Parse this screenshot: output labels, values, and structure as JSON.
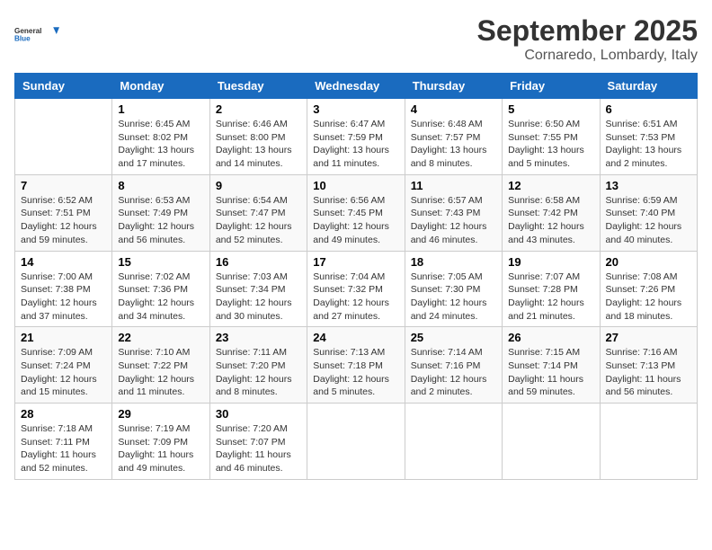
{
  "header": {
    "logo_line1": "General",
    "logo_line2": "Blue",
    "month_title": "September 2025",
    "location": "Cornaredo, Lombardy, Italy"
  },
  "days_of_week": [
    "Sunday",
    "Monday",
    "Tuesday",
    "Wednesday",
    "Thursday",
    "Friday",
    "Saturday"
  ],
  "weeks": [
    [
      {
        "day": "",
        "info": ""
      },
      {
        "day": "1",
        "info": "Sunrise: 6:45 AM\nSunset: 8:02 PM\nDaylight: 13 hours\nand 17 minutes."
      },
      {
        "day": "2",
        "info": "Sunrise: 6:46 AM\nSunset: 8:00 PM\nDaylight: 13 hours\nand 14 minutes."
      },
      {
        "day": "3",
        "info": "Sunrise: 6:47 AM\nSunset: 7:59 PM\nDaylight: 13 hours\nand 11 minutes."
      },
      {
        "day": "4",
        "info": "Sunrise: 6:48 AM\nSunset: 7:57 PM\nDaylight: 13 hours\nand 8 minutes."
      },
      {
        "day": "5",
        "info": "Sunrise: 6:50 AM\nSunset: 7:55 PM\nDaylight: 13 hours\nand 5 minutes."
      },
      {
        "day": "6",
        "info": "Sunrise: 6:51 AM\nSunset: 7:53 PM\nDaylight: 13 hours\nand 2 minutes."
      }
    ],
    [
      {
        "day": "7",
        "info": "Sunrise: 6:52 AM\nSunset: 7:51 PM\nDaylight: 12 hours\nand 59 minutes."
      },
      {
        "day": "8",
        "info": "Sunrise: 6:53 AM\nSunset: 7:49 PM\nDaylight: 12 hours\nand 56 minutes."
      },
      {
        "day": "9",
        "info": "Sunrise: 6:54 AM\nSunset: 7:47 PM\nDaylight: 12 hours\nand 52 minutes."
      },
      {
        "day": "10",
        "info": "Sunrise: 6:56 AM\nSunset: 7:45 PM\nDaylight: 12 hours\nand 49 minutes."
      },
      {
        "day": "11",
        "info": "Sunrise: 6:57 AM\nSunset: 7:43 PM\nDaylight: 12 hours\nand 46 minutes."
      },
      {
        "day": "12",
        "info": "Sunrise: 6:58 AM\nSunset: 7:42 PM\nDaylight: 12 hours\nand 43 minutes."
      },
      {
        "day": "13",
        "info": "Sunrise: 6:59 AM\nSunset: 7:40 PM\nDaylight: 12 hours\nand 40 minutes."
      }
    ],
    [
      {
        "day": "14",
        "info": "Sunrise: 7:00 AM\nSunset: 7:38 PM\nDaylight: 12 hours\nand 37 minutes."
      },
      {
        "day": "15",
        "info": "Sunrise: 7:02 AM\nSunset: 7:36 PM\nDaylight: 12 hours\nand 34 minutes."
      },
      {
        "day": "16",
        "info": "Sunrise: 7:03 AM\nSunset: 7:34 PM\nDaylight: 12 hours\nand 30 minutes."
      },
      {
        "day": "17",
        "info": "Sunrise: 7:04 AM\nSunset: 7:32 PM\nDaylight: 12 hours\nand 27 minutes."
      },
      {
        "day": "18",
        "info": "Sunrise: 7:05 AM\nSunset: 7:30 PM\nDaylight: 12 hours\nand 24 minutes."
      },
      {
        "day": "19",
        "info": "Sunrise: 7:07 AM\nSunset: 7:28 PM\nDaylight: 12 hours\nand 21 minutes."
      },
      {
        "day": "20",
        "info": "Sunrise: 7:08 AM\nSunset: 7:26 PM\nDaylight: 12 hours\nand 18 minutes."
      }
    ],
    [
      {
        "day": "21",
        "info": "Sunrise: 7:09 AM\nSunset: 7:24 PM\nDaylight: 12 hours\nand 15 minutes."
      },
      {
        "day": "22",
        "info": "Sunrise: 7:10 AM\nSunset: 7:22 PM\nDaylight: 12 hours\nand 11 minutes."
      },
      {
        "day": "23",
        "info": "Sunrise: 7:11 AM\nSunset: 7:20 PM\nDaylight: 12 hours\nand 8 minutes."
      },
      {
        "day": "24",
        "info": "Sunrise: 7:13 AM\nSunset: 7:18 PM\nDaylight: 12 hours\nand 5 minutes."
      },
      {
        "day": "25",
        "info": "Sunrise: 7:14 AM\nSunset: 7:16 PM\nDaylight: 12 hours\nand 2 minutes."
      },
      {
        "day": "26",
        "info": "Sunrise: 7:15 AM\nSunset: 7:14 PM\nDaylight: 11 hours\nand 59 minutes."
      },
      {
        "day": "27",
        "info": "Sunrise: 7:16 AM\nSunset: 7:13 PM\nDaylight: 11 hours\nand 56 minutes."
      }
    ],
    [
      {
        "day": "28",
        "info": "Sunrise: 7:18 AM\nSunset: 7:11 PM\nDaylight: 11 hours\nand 52 minutes."
      },
      {
        "day": "29",
        "info": "Sunrise: 7:19 AM\nSunset: 7:09 PM\nDaylight: 11 hours\nand 49 minutes."
      },
      {
        "day": "30",
        "info": "Sunrise: 7:20 AM\nSunset: 7:07 PM\nDaylight: 11 hours\nand 46 minutes."
      },
      {
        "day": "",
        "info": ""
      },
      {
        "day": "",
        "info": ""
      },
      {
        "day": "",
        "info": ""
      },
      {
        "day": "",
        "info": ""
      }
    ]
  ]
}
